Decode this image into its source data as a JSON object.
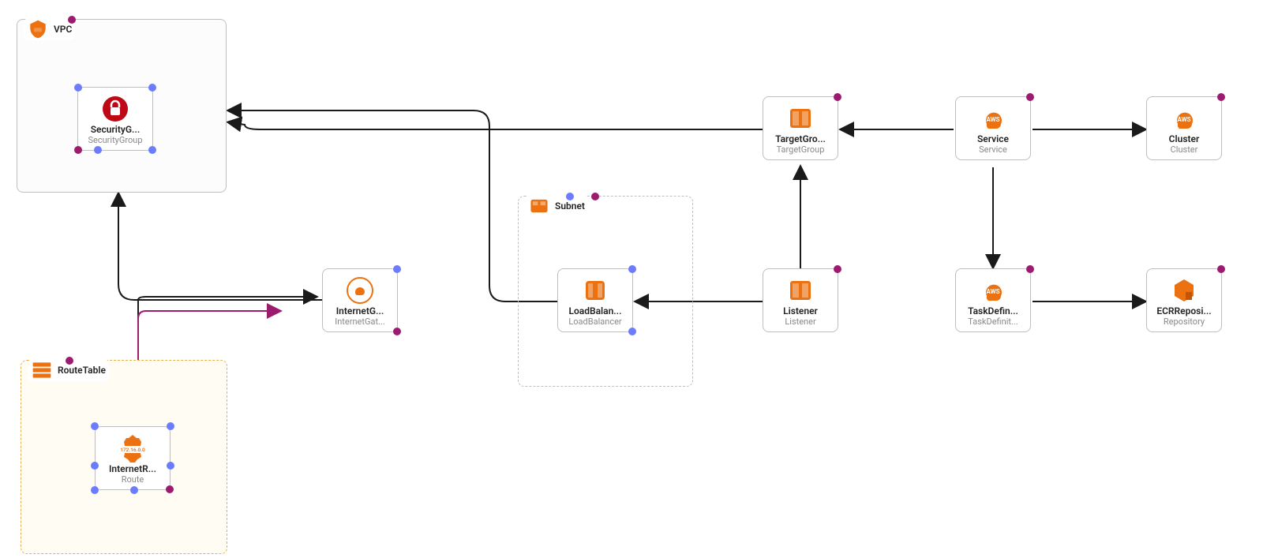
{
  "groups": {
    "vpc": {
      "label": "VPC"
    },
    "subnet": {
      "label": "Subnet"
    },
    "routeTable": {
      "label": "RouteTable"
    }
  },
  "nodes": {
    "securityGroup": {
      "title": "SecurityG...",
      "subtitle": "SecurityGroup"
    },
    "internetGateway": {
      "title": "InternetG...",
      "subtitle": "InternetGat..."
    },
    "loadBalancer": {
      "title": "LoadBalan...",
      "subtitle": "LoadBalancer"
    },
    "targetGroup": {
      "title": "TargetGro...",
      "subtitle": "TargetGroup"
    },
    "listener": {
      "title": "Listener",
      "subtitle": "Listener"
    },
    "service": {
      "title": "Service",
      "subtitle": "Service"
    },
    "cluster": {
      "title": "Cluster",
      "subtitle": "Cluster"
    },
    "taskDefinition": {
      "title": "TaskDefin...",
      "subtitle": "TaskDefinit..."
    },
    "ecrRepository": {
      "title": "ECRReposi...",
      "subtitle": "Repository"
    },
    "internetRoute": {
      "title": "InternetR...",
      "subtitle": "Route",
      "badge": "172.16.0.0"
    }
  },
  "colors": {
    "port_blue": "#6b7cff",
    "port_purple": "#9c1b6f",
    "aws_orange": "#ec7211",
    "aws_red": "#bf0816"
  },
  "edges": [
    {
      "from": "internetGateway",
      "to": "vpc"
    },
    {
      "from": "loadBalancer",
      "to": "securityGroup"
    },
    {
      "from": "targetGroup",
      "to": "securityGroup"
    },
    {
      "from": "listener",
      "to": "loadBalancer"
    },
    {
      "from": "listener",
      "to": "targetGroup"
    },
    {
      "from": "service",
      "to": "targetGroup"
    },
    {
      "from": "service",
      "to": "cluster"
    },
    {
      "from": "service",
      "to": "taskDefinition"
    },
    {
      "from": "taskDefinition",
      "to": "ecrRepository"
    },
    {
      "from": "internetRoute",
      "to": "internetGateway",
      "style": "purple"
    },
    {
      "from": "routeTable",
      "to": "internetGateway",
      "style": "black"
    }
  ]
}
